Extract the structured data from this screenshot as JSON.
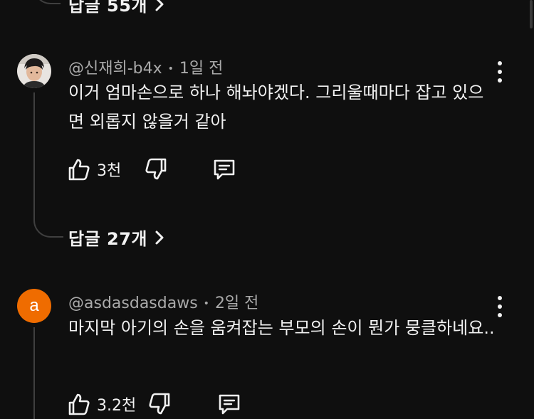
{
  "top_replies": {
    "label": "답글 55개"
  },
  "comments": [
    {
      "author": "@신재희-b4x",
      "time": "1일 전",
      "text": "이거 엄마손으로 하나 해놔야겠다. 그리울때마다 잡고 있으면 외롭지 않을거 같아",
      "likes": "3천",
      "replies_label": "답글 27개",
      "avatar": "photo"
    },
    {
      "author": "@asdasdasdaws",
      "time": "2일 전",
      "text": "마지막 아기의 손을 움켜잡는 부모의 손이 뭔가 뭉클하네요..",
      "likes": "3.2천",
      "avatar_letter": "a",
      "avatar_color": "#ef6c00"
    }
  ],
  "colors": {
    "background": "#0f0f0f",
    "text_primary": "#f1f1f1",
    "text_secondary": "#aaaaaa",
    "thread_line": "#3f3f3f"
  }
}
